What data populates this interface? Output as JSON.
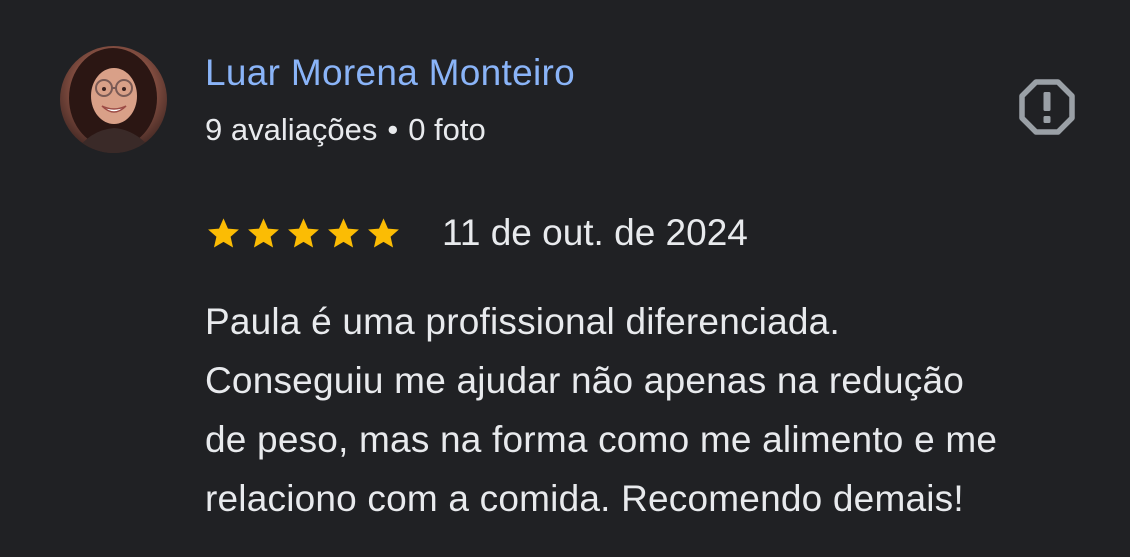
{
  "review": {
    "author_name": "Luar Morena Monteiro",
    "reviews_count": "9 avaliações",
    "separator": "•",
    "photos_count": "0 foto",
    "rating": 5,
    "max_rating": 5,
    "date": "11 de out. de 2024",
    "text_lines": [
      "Paula é uma profissional diferenciada.",
      "Conseguiu me ajudar não apenas na redução",
      "de peso, mas na forma como me alimento e me",
      "relaciono com a comida. Recomendo demais!"
    ]
  },
  "icons": {
    "report": "report-flag-icon",
    "star": "star-icon",
    "avatar": "profile-photo"
  },
  "colors": {
    "background": "#202124",
    "author_name": "#8ab4f8",
    "text": "#e8eaed",
    "star": "#fbbc04",
    "report_icon": "#9aa0a6"
  }
}
